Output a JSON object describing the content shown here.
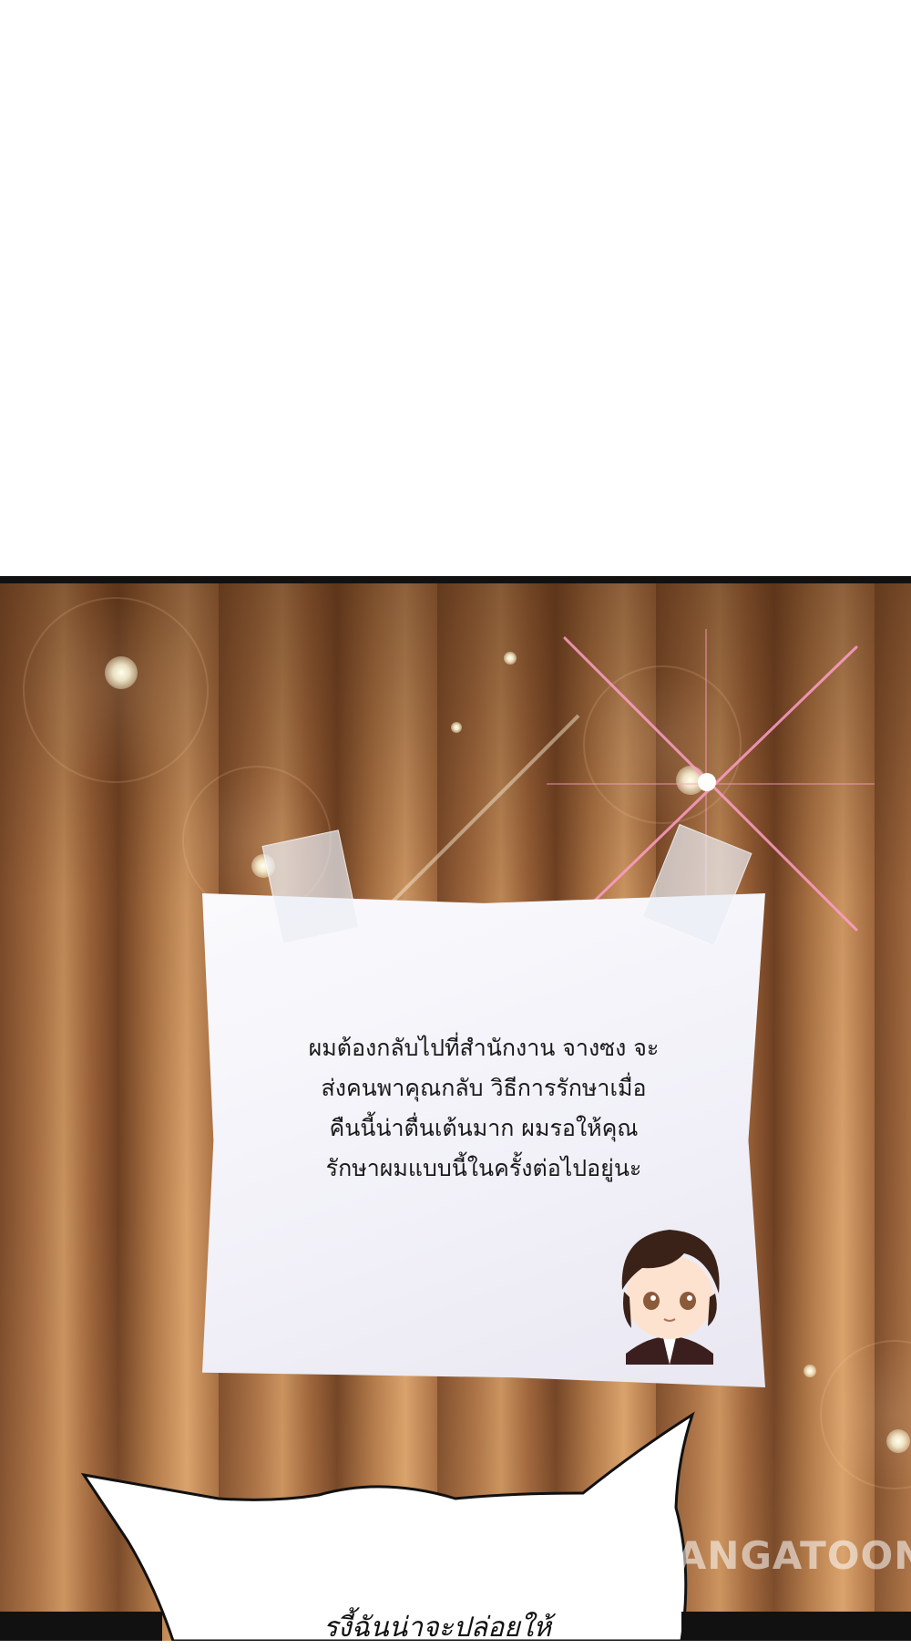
{
  "note": {
    "lines": [
      "ผมต้องกลับไปที่สำนักงาน จางซง จะ",
      "ส่งคนพาคุณกลับ วิธีการรักษาเมื่อ",
      "คืนนี้น่าตื่นเต้นมาก ผมรอให้คุณ",
      "รักษาผมแบบนี้ในครั้งต่อไปอยู่นะ"
    ]
  },
  "bubble": {
    "text": "รงี้ฉันน่าจะปล่อยให้"
  },
  "watermark": {
    "text": "MANGATOON"
  },
  "colors": {
    "border": "#111111",
    "note_text": "#1a1a1a",
    "sparkle": "#ff9ec8"
  }
}
